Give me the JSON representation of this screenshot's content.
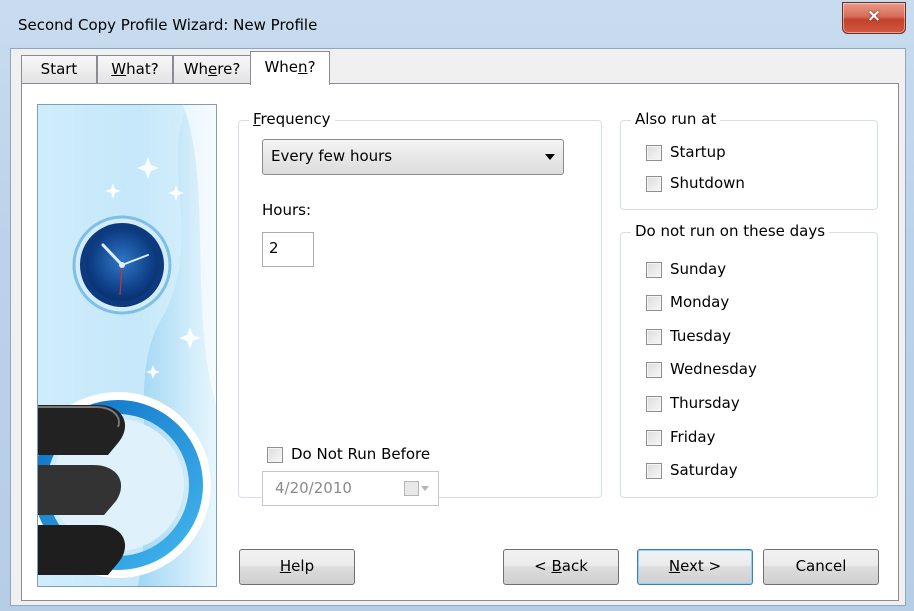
{
  "window": {
    "title": "Second Copy Profile Wizard: New Profile",
    "close_glyph": "×"
  },
  "tabs": [
    {
      "label_pre": "Start",
      "label_u": "",
      "label_post": ""
    },
    {
      "label_pre": "",
      "label_u": "W",
      "label_post": "hat?"
    },
    {
      "label_pre": "Wh",
      "label_u": "e",
      "label_post": "re?"
    },
    {
      "label_pre": "Whe",
      "label_u": "n",
      "label_post": "?"
    }
  ],
  "active_tab": "When?",
  "frequency": {
    "legend_u": "F",
    "legend_rest": "requency",
    "selected": "Every few hours",
    "hours_label": "Hours:",
    "hours_value": "2",
    "do_not_run_before_label": "Do Not Run Before",
    "do_not_run_before_checked": false,
    "date_value": "4/20/2010"
  },
  "also_run_at": {
    "legend": "Also run at",
    "items": [
      {
        "label": "Startup",
        "checked": false
      },
      {
        "label": "Shutdown",
        "checked": false
      }
    ]
  },
  "do_not_run_days": {
    "legend": "Do not run on these days",
    "items": [
      {
        "label": "Sunday",
        "checked": false
      },
      {
        "label": "Monday",
        "checked": false
      },
      {
        "label": "Tuesday",
        "checked": false
      },
      {
        "label": "Wednesday",
        "checked": false
      },
      {
        "label": "Thursday",
        "checked": false
      },
      {
        "label": "Friday",
        "checked": false
      },
      {
        "label": "Saturday",
        "checked": false
      }
    ]
  },
  "buttons": {
    "help": {
      "u": "H",
      "rest": "elp"
    },
    "back": {
      "pre": "< ",
      "u": "B",
      "rest": "ack"
    },
    "next": {
      "u": "N",
      "rest": "ext >"
    },
    "cancel": "Cancel"
  },
  "colors": {
    "close_button": "#c2422b",
    "banner_blue": "#2a9ad8",
    "default_button_border": "#3c7fb1"
  }
}
